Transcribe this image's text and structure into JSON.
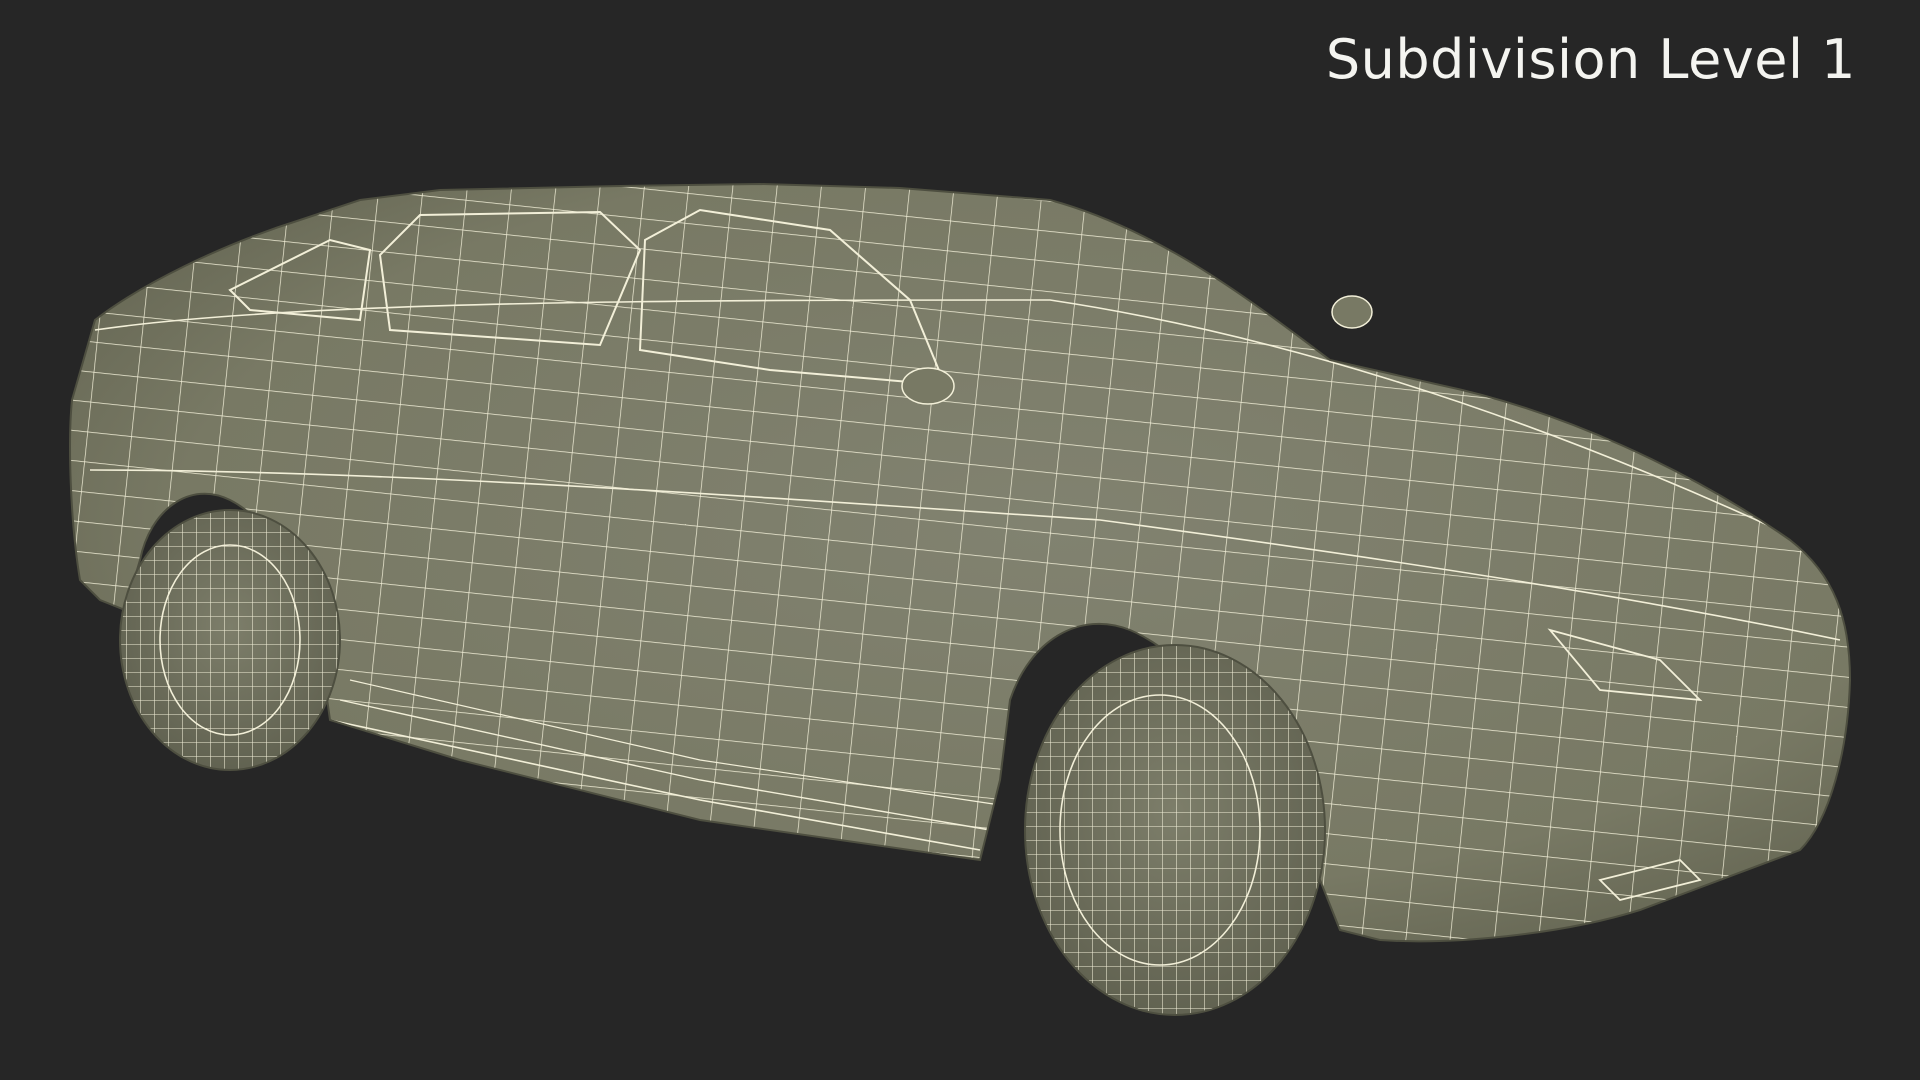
{
  "title": "Subdivision Level 1",
  "colors": {
    "background": "#262626",
    "surface": "#7a7b66",
    "surface_shade": "#6b6c58",
    "wire": "#f2efd8",
    "label": "#f4f4f0"
  }
}
